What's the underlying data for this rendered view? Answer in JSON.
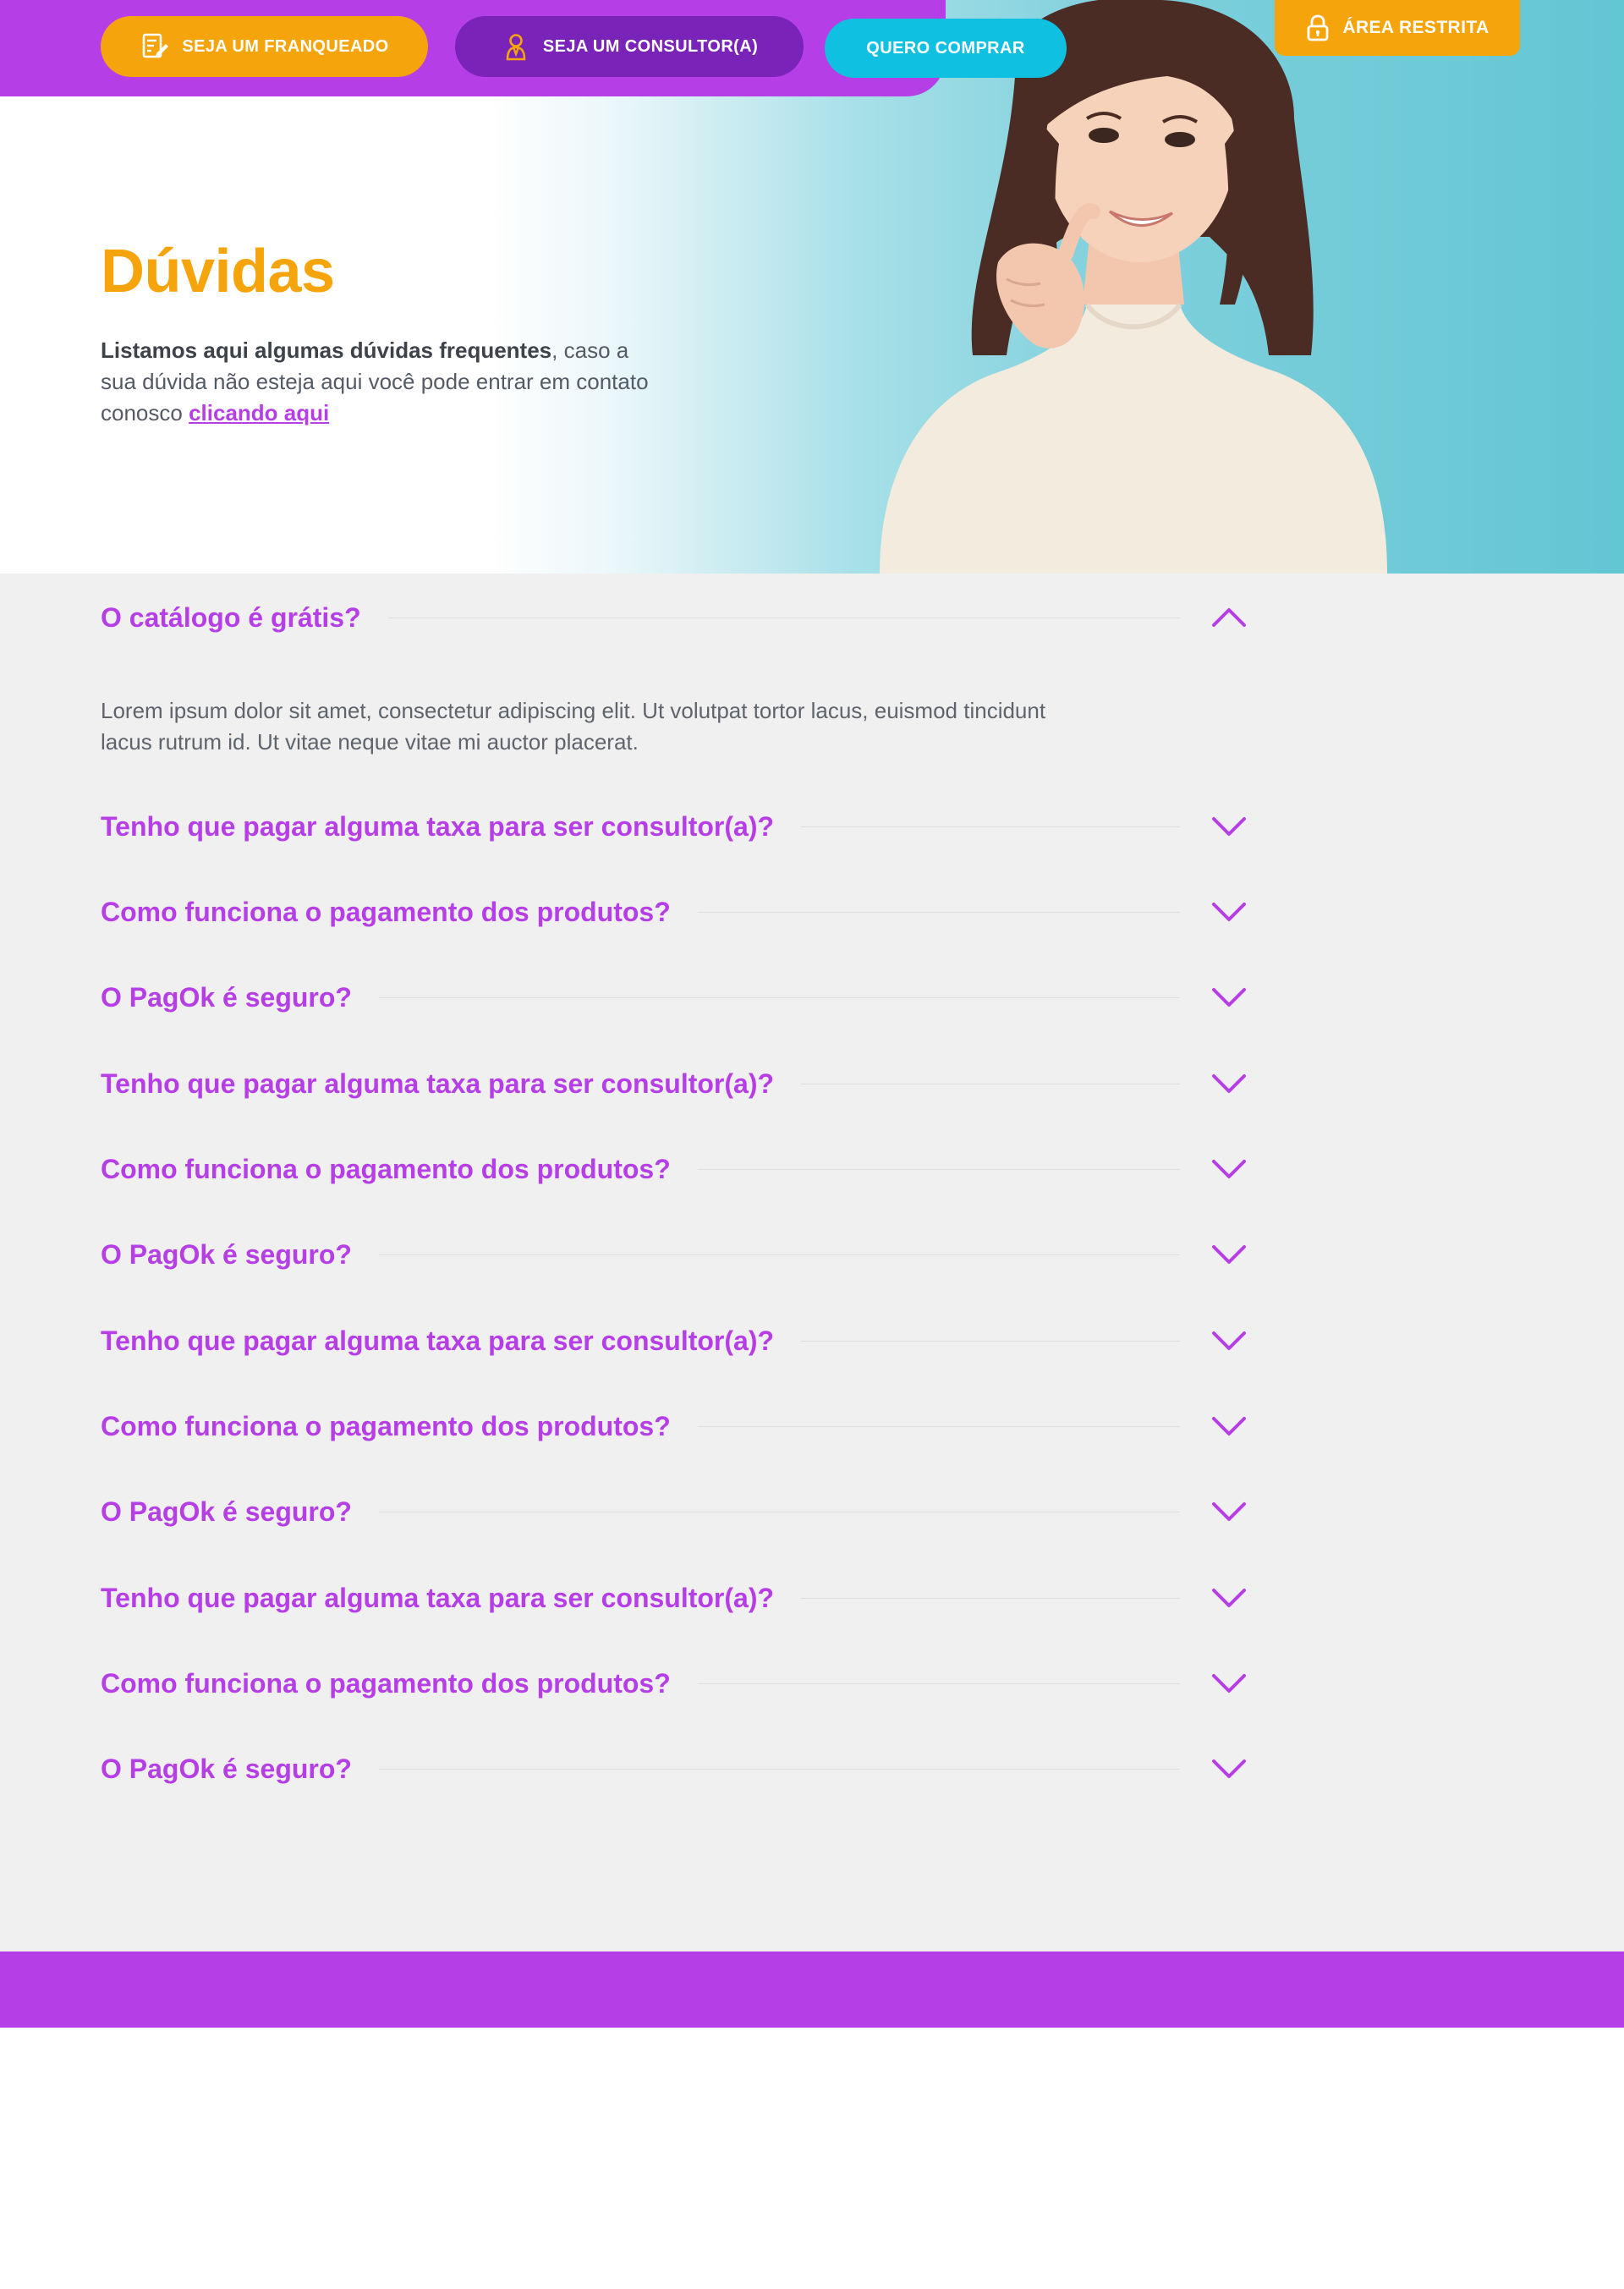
{
  "header": {
    "franqueado_label": "SEJA UM FRANQUEADO",
    "consultor_label": "SEJA UM CONSULTOR(A)",
    "comprar_label": "QUERO COMPRAR",
    "area_label": "ÁREA RESTRITA"
  },
  "hero": {
    "title": "Dúvidas",
    "desc_bold": "Listamos aqui algumas dúvidas frequentes",
    "desc_comma": ",",
    "desc_rest": "caso a sua dúvida não esteja aqui você pode entrar em contato conosco",
    "link": "clicando aqui"
  },
  "faq": {
    "items": [
      {
        "question": "O catálogo é grátis?",
        "answer": "Lorem ipsum dolor sit amet, consectetur adipiscing elit. Ut volutpat tortor lacus, euismod tincidunt lacus rutrum id. Ut vitae neque vitae mi auctor placerat.",
        "expanded": true
      },
      {
        "question": "Tenho que pagar alguma taxa para ser consultor(a)?",
        "expanded": false
      },
      {
        "question": "Como funciona o pagamento dos produtos?",
        "expanded": false
      },
      {
        "question": "O PagOk é seguro?",
        "expanded": false
      },
      {
        "question": "Tenho que pagar alguma taxa para ser consultor(a)?",
        "expanded": false
      },
      {
        "question": "Como funciona o pagamento dos produtos?",
        "expanded": false
      },
      {
        "question": "O PagOk é seguro?",
        "expanded": false
      },
      {
        "question": "Tenho que pagar alguma taxa para ser consultor(a)?",
        "expanded": false
      },
      {
        "question": "Como funciona o pagamento dos produtos?",
        "expanded": false
      },
      {
        "question": "O PagOk é seguro?",
        "expanded": false
      },
      {
        "question": "Tenho que pagar alguma taxa para ser consultor(a)?",
        "expanded": false
      },
      {
        "question": "Como funciona o pagamento dos produtos?",
        "expanded": false
      },
      {
        "question": "O PagOk é seguro?",
        "expanded": false
      }
    ]
  },
  "colors": {
    "purple": "#b63ee6",
    "dark_purple": "#7a23b8",
    "orange": "#f5a50b",
    "cyan": "#0fc0e0",
    "faq_background": "#f0f0f0"
  },
  "icons": {
    "franqueado": "document-pen-icon",
    "consultor": "consultant-person-icon",
    "area": "lock-icon",
    "faq_open": "chevron-up-icon",
    "faq_closed": "chevron-down-icon"
  }
}
